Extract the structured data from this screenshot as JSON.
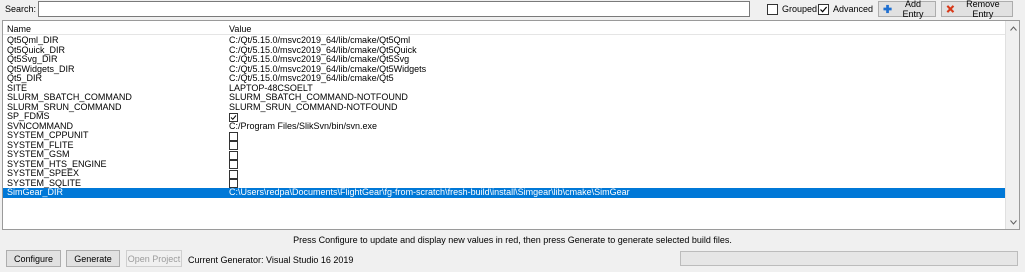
{
  "toolbar": {
    "search_label": "Search:",
    "search_value": "",
    "grouped_label": "Grouped",
    "grouped_checked": false,
    "advanced_label": "Advanced",
    "advanced_checked": true,
    "add_entry_label": "Add Entry",
    "remove_entry_label": "Remove Entry"
  },
  "table": {
    "headers": {
      "name": "Name",
      "value": "Value"
    },
    "rows": [
      {
        "name": "Qt5Qml_DIR",
        "type": "text",
        "value": "C:/Qt/5.15.0/msvc2019_64/lib/cmake/Qt5Qml"
      },
      {
        "name": "Qt5Quick_DIR",
        "type": "text",
        "value": "C:/Qt/5.15.0/msvc2019_64/lib/cmake/Qt5Quick"
      },
      {
        "name": "Qt5Svg_DIR",
        "type": "text",
        "value": "C:/Qt/5.15.0/msvc2019_64/lib/cmake/Qt5Svg"
      },
      {
        "name": "Qt5Widgets_DIR",
        "type": "text",
        "value": "C:/Qt/5.15.0/msvc2019_64/lib/cmake/Qt5Widgets"
      },
      {
        "name": "Qt5_DIR",
        "type": "text",
        "value": "C:/Qt/5.15.0/msvc2019_64/lib/cmake/Qt5"
      },
      {
        "name": "SITE",
        "type": "text",
        "value": "LAPTOP-48CSOELT"
      },
      {
        "name": "SLURM_SBATCH_COMMAND",
        "type": "text",
        "value": "SLURM_SBATCH_COMMAND-NOTFOUND"
      },
      {
        "name": "SLURM_SRUN_COMMAND",
        "type": "text",
        "value": "SLURM_SRUN_COMMAND-NOTFOUND"
      },
      {
        "name": "SP_FDMS",
        "type": "bool",
        "checked": true
      },
      {
        "name": "SVNCOMMAND",
        "type": "text",
        "value": "C:/Program Files/SlikSvn/bin/svn.exe"
      },
      {
        "name": "SYSTEM_CPPUNIT",
        "type": "bool",
        "checked": false
      },
      {
        "name": "SYSTEM_FLITE",
        "type": "bool",
        "checked": false
      },
      {
        "name": "SYSTEM_GSM",
        "type": "bool",
        "checked": false
      },
      {
        "name": "SYSTEM_HTS_ENGINE",
        "type": "bool",
        "checked": false
      },
      {
        "name": "SYSTEM_SPEEX",
        "type": "bool",
        "checked": false
      },
      {
        "name": "SYSTEM_SQLITE",
        "type": "bool",
        "checked": false
      },
      {
        "name": "SimGear_DIR",
        "type": "text",
        "value": "C:\\Users\\redpa\\Documents\\FlightGear\\fg-from-scratch\\fresh-build\\install\\Simgear\\lib\\cmake\\SimGear",
        "selected": true
      }
    ]
  },
  "status_text": "Press Configure to update and display new values in red, then press Generate to generate selected build files.",
  "bottom": {
    "configure_label": "Configure",
    "generate_label": "Generate",
    "open_project_label": "Open Project",
    "generator_text": "Current Generator: Visual Studio 16 2019"
  },
  "colors": {
    "selection": "#0078d7",
    "add_icon": "#1f6fd0",
    "remove_icon": "#d83a1a"
  }
}
